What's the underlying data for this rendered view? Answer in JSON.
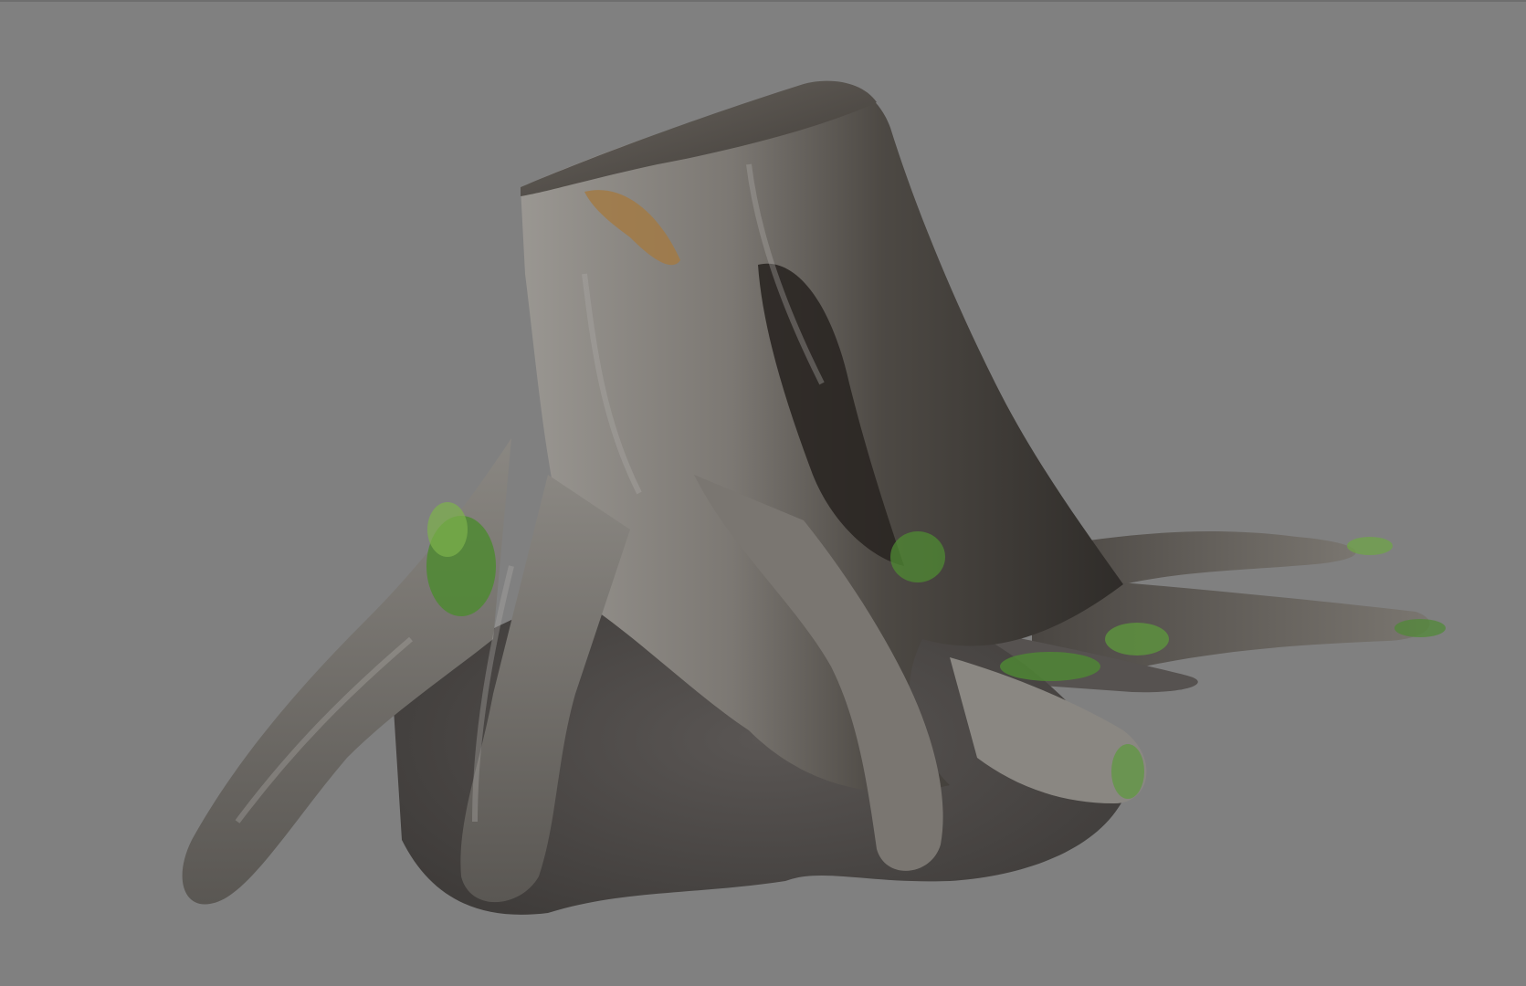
{
  "scene": {
    "subject": "tree-stump-3d-model",
    "colors": {
      "background": "#808080",
      "bark_light": "#8e8b86",
      "bark_mid": "#5f5c57",
      "bark_dark": "#2e2b27",
      "cut_top": "#4a4540",
      "exposed_wood": "#a27a45",
      "soil": "#4b4745",
      "moss": "#4f8a33",
      "moss_light": "#7db24c"
    }
  }
}
